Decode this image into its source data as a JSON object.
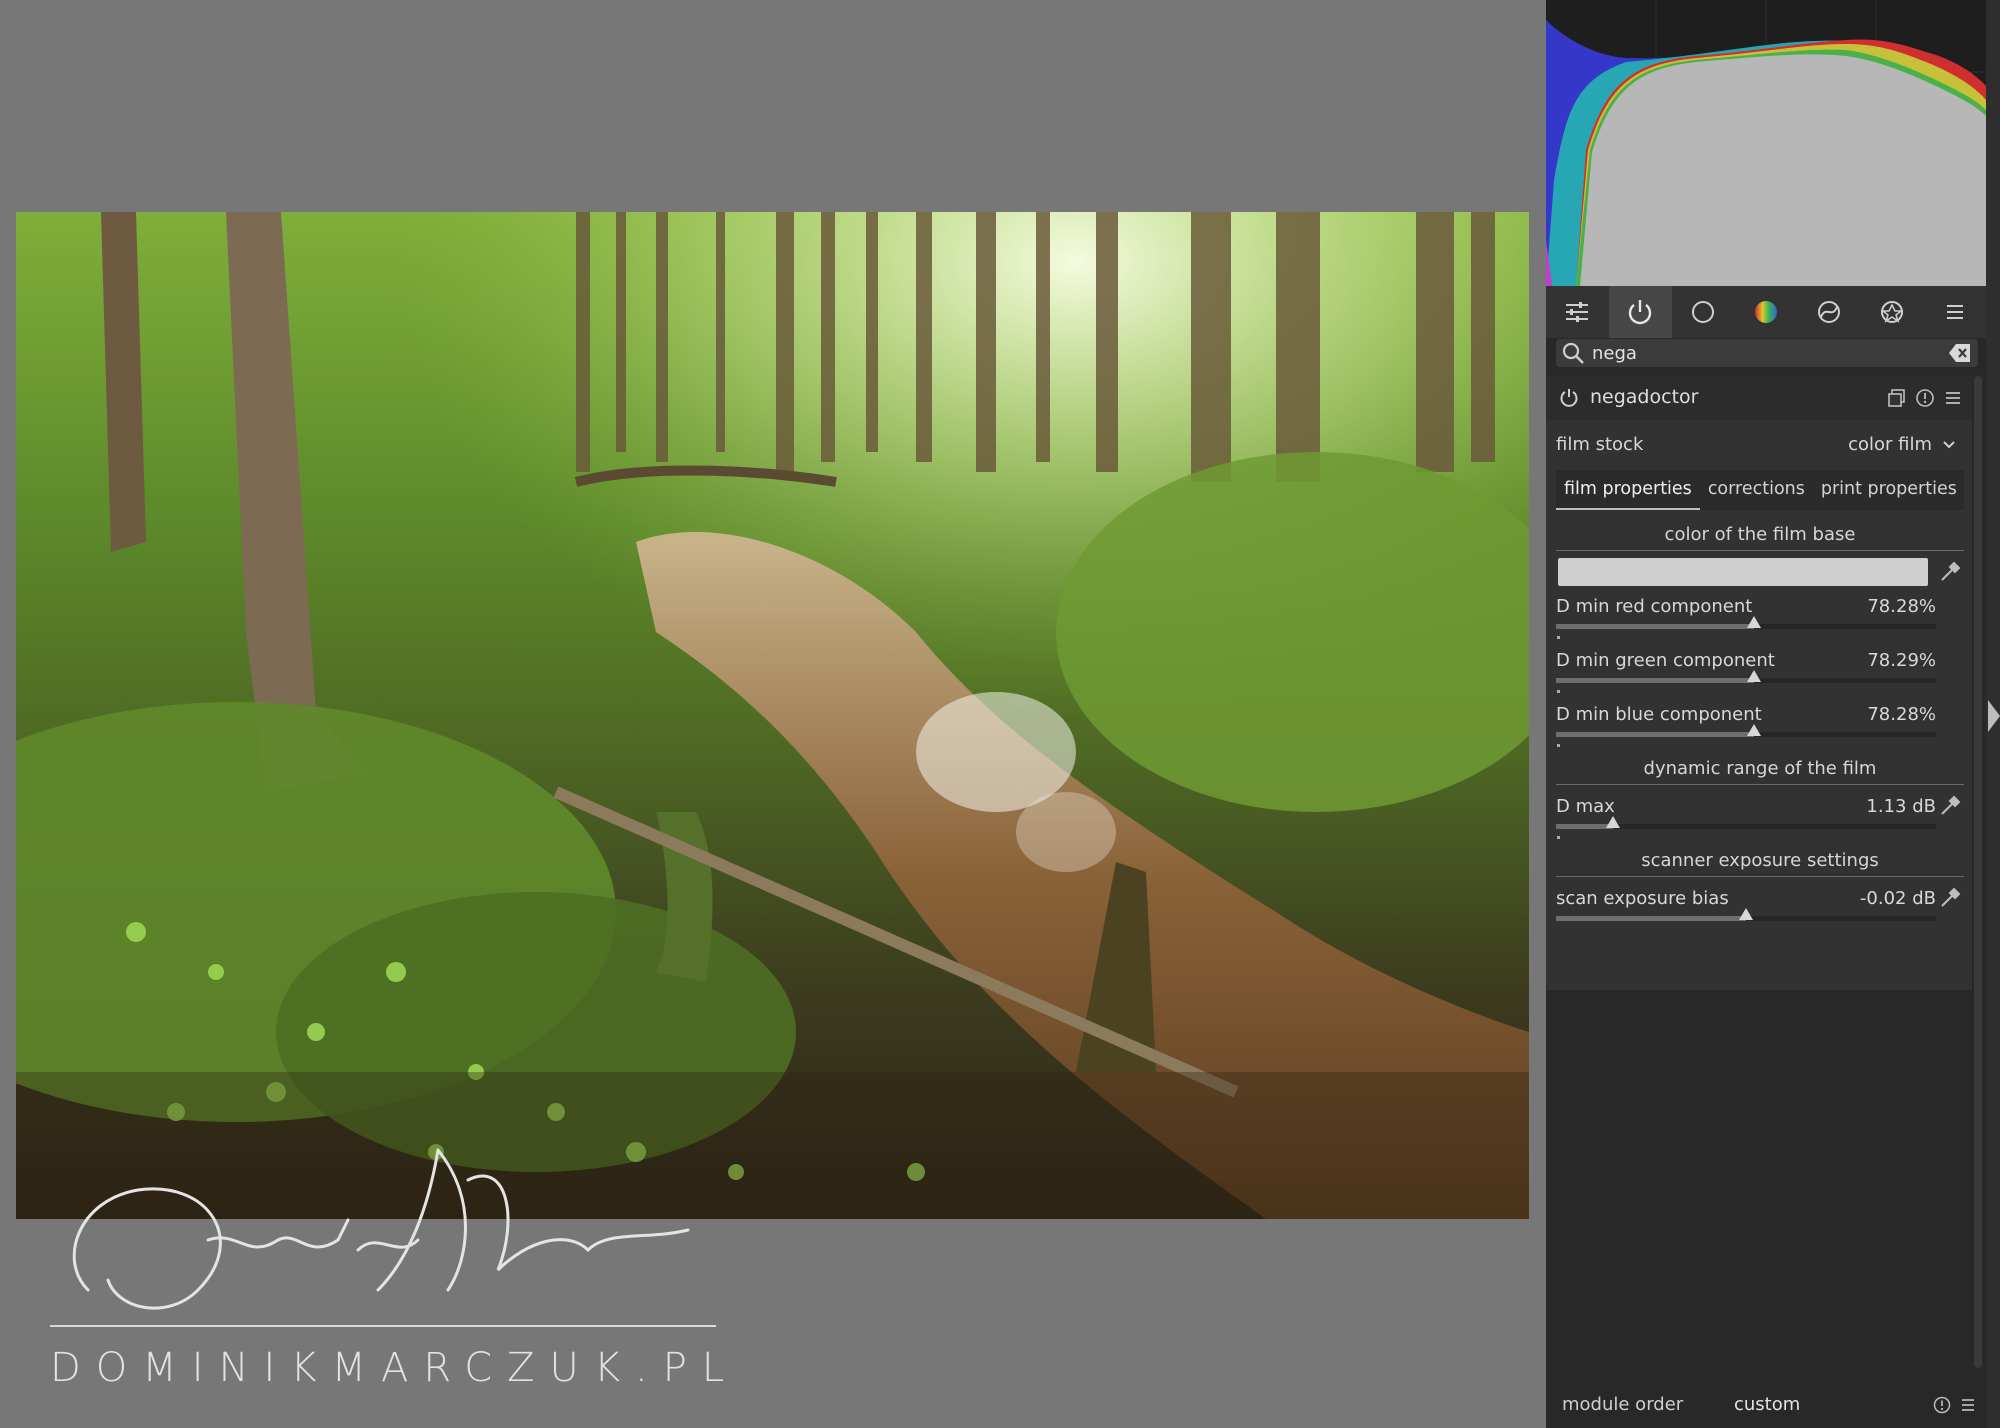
{
  "photo": {
    "watermark_signature": "Dominik Marczuk",
    "watermark_url": "DOMINIKMARCZUK.PL"
  },
  "tabs": [
    {
      "icon": "sliders-icon"
    },
    {
      "icon": "power-icon"
    },
    {
      "icon": "circle-icon"
    },
    {
      "icon": "color-wheel-icon"
    },
    {
      "icon": "correct-icon"
    },
    {
      "icon": "effect-icon"
    },
    {
      "icon": "hamburger-icon"
    }
  ],
  "search": {
    "value": "nega",
    "placeholder": "search modules by name"
  },
  "module": {
    "name": "negadoctor",
    "film_stock_label": "film stock",
    "film_stock_value": "color film",
    "notebook_tabs": [
      "film properties",
      "corrections",
      "print properties"
    ],
    "sections": {
      "film_base": "color of the film base",
      "dynamic_range": "dynamic range of the film",
      "scanner": "scanner exposure settings"
    },
    "film_base_color": "#cfcfcf",
    "sliders": [
      {
        "label": "D min red component",
        "value": "78.28%",
        "position": 0.52
      },
      {
        "label": "D min green component",
        "value": "78.29%",
        "position": 0.52
      },
      {
        "label": "D min blue component",
        "value": "78.28%",
        "position": 0.52
      },
      {
        "label": "D max",
        "value": "1.13 dB",
        "position": 0.15
      },
      {
        "label": "scan exposure bias",
        "value": "-0.02 dB",
        "position": 0.5
      }
    ]
  },
  "bottom": {
    "module_order_label": "module order",
    "module_order_value": "custom"
  }
}
